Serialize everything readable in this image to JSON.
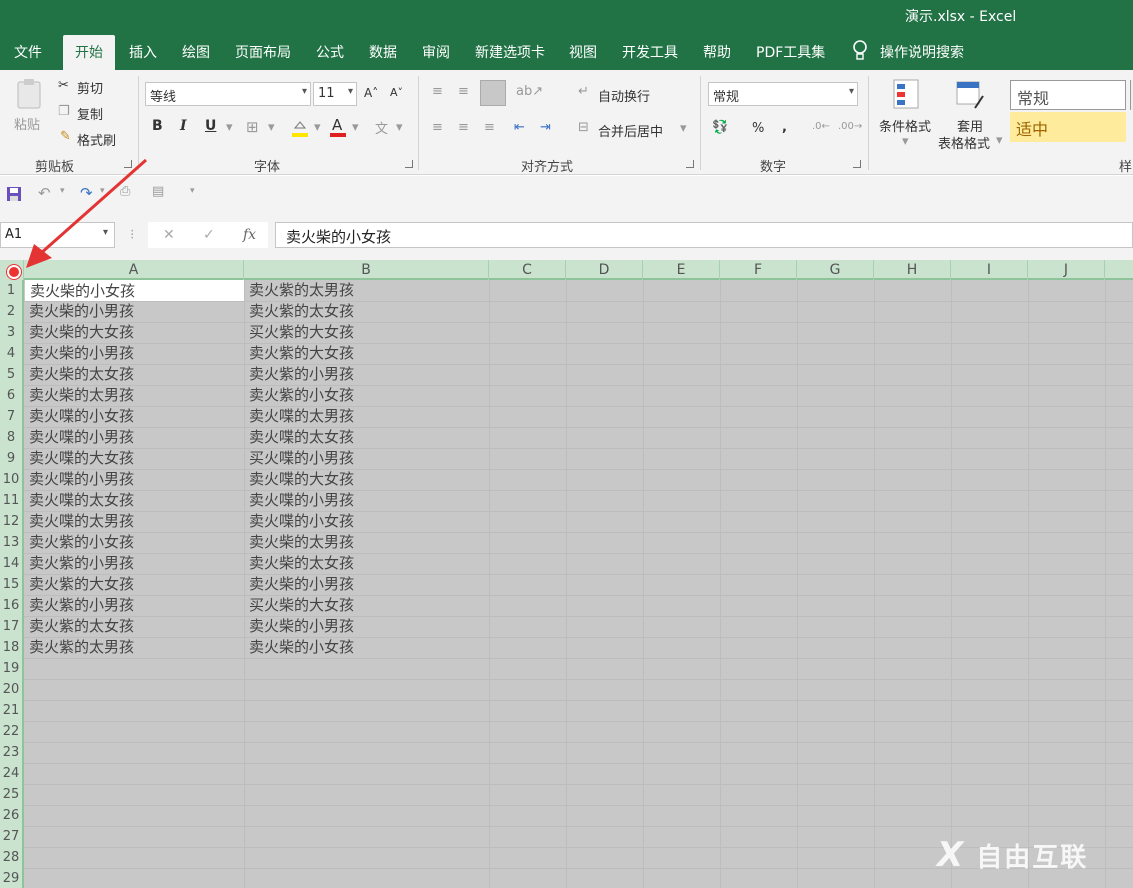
{
  "window": {
    "title": "演示.xlsx - Excel"
  },
  "tabs": [
    "文件",
    "开始",
    "插入",
    "绘图",
    "页面布局",
    "公式",
    "数据",
    "审阅",
    "新建选项卡",
    "视图",
    "开发工具",
    "帮助",
    "PDF工具集"
  ],
  "active_tab": "开始",
  "tell_me": "操作说明搜索",
  "ribbon": {
    "clipboard": {
      "paste": "粘贴",
      "cut": "剪切",
      "copy": "复制",
      "format_painter": "格式刷",
      "label": "剪贴板"
    },
    "font": {
      "name": "等线",
      "size": "11",
      "label": "字体",
      "bold": "B",
      "italic": "I",
      "underline": "U"
    },
    "alignment": {
      "wrap_text": "自动换行",
      "merge_center": "合并后居中",
      "label": "对齐方式"
    },
    "number": {
      "format": "常规",
      "percent": "%",
      "comma": ",",
      "label": "数字"
    },
    "styles": {
      "conditional": "条件格式",
      "table_format_line1": "套用",
      "table_format_line2": "表格格式",
      "style_normal": "常规",
      "style_neutral": "适中",
      "label": "样"
    }
  },
  "formula_bar": {
    "name_box": "A1",
    "fx": "fx",
    "value": "卖火柴的小女孩"
  },
  "columns": [
    "A",
    "B",
    "C",
    "D",
    "E",
    "F",
    "G",
    "H",
    "I",
    "J"
  ],
  "rows": [
    "1",
    "2",
    "3",
    "4",
    "5",
    "6",
    "7",
    "8",
    "9",
    "10",
    "11",
    "12",
    "13",
    "14",
    "15",
    "16",
    "17",
    "18",
    "19",
    "20",
    "21",
    "22",
    "23",
    "24",
    "25",
    "26",
    "27",
    "28",
    "29"
  ],
  "data": {
    "A": [
      "卖火柴的小女孩",
      "卖火柴的小男孩",
      "卖火柴的大女孩",
      "卖火柴的小男孩",
      "卖火柴的太女孩",
      "卖火柴的太男孩",
      "卖火喋的小女孩",
      "卖火喋的小男孩",
      "卖火喋的大女孩",
      "卖火喋的小男孩",
      "卖火喋的太女孩",
      "卖火喋的太男孩",
      "卖火紫的小女孩",
      "卖火紫的小男孩",
      "卖火紫的大女孩",
      "卖火紫的小男孩",
      "卖火紫的太女孩",
      "卖火紫的太男孩"
    ],
    "B": [
      "卖火紫的太男孩",
      "卖火紫的太女孩",
      "买火紫的大女孩",
      "卖火紫的大女孩",
      "卖火紫的小男孩",
      "卖火紫的小女孩",
      "卖火喋的太男孩",
      "卖火喋的太女孩",
      "买火喋的小男孩",
      "卖火喋的大女孩",
      "卖火喋的小男孩",
      "卖火喋的小女孩",
      "卖火柴的太男孩",
      "卖火柴的太女孩",
      "卖火柴的小男孩",
      "买火柴的大女孩",
      "卖火柴的小男孩",
      "卖火柴的小女孩"
    ]
  },
  "watermark": "自由互联",
  "colors": {
    "excel_green": "#217346",
    "selection_gray": "#c8c8c8",
    "header_green": "#c9e3cf",
    "arrow_red": "#e33333"
  }
}
